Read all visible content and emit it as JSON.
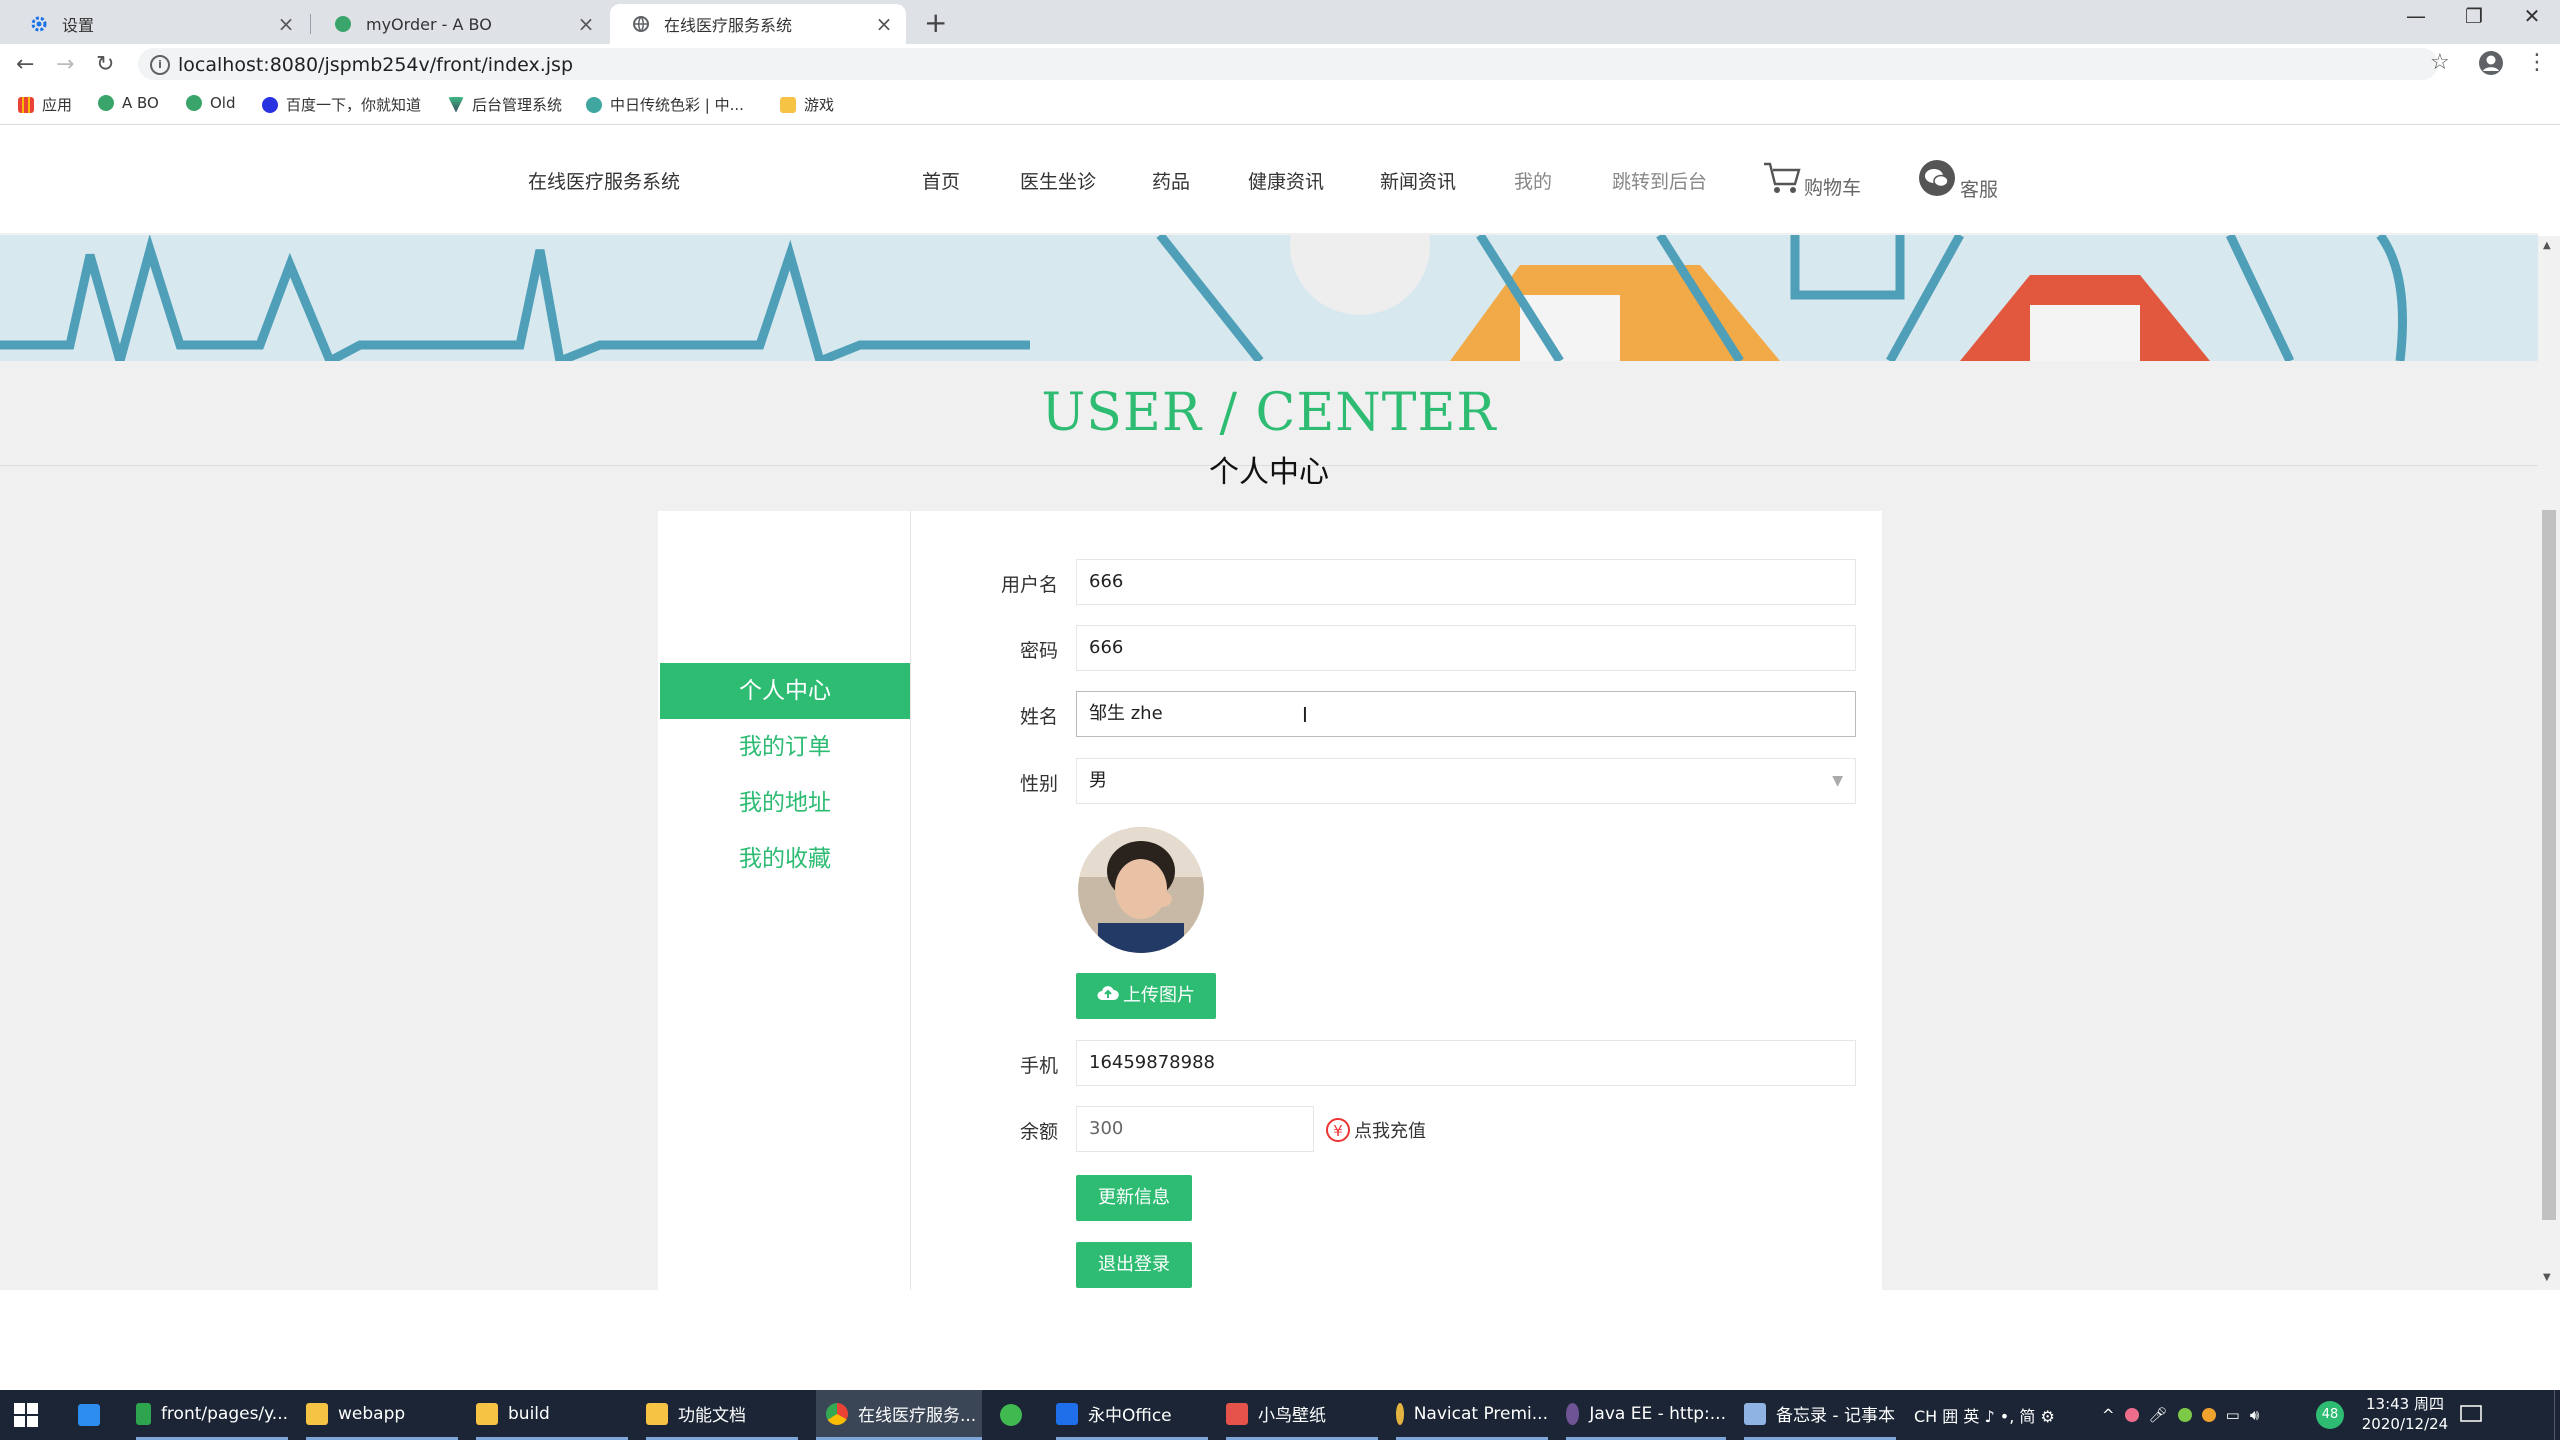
{
  "browser": {
    "tabs": [
      {
        "title": "设置"
      },
      {
        "title": "myOrder - A BO"
      },
      {
        "title": "在线医疗服务系统"
      }
    ],
    "url": "localhost:8080/jspmb254v/front/index.jsp",
    "bookmarks": [
      "应用",
      "A BO",
      "Old",
      "百度一下，你就知道",
      "后台管理系统",
      "中日传统色彩 | 中...",
      "游戏"
    ]
  },
  "site": {
    "brand": "在线医疗服务系统",
    "nav": [
      "首页",
      "医生坐诊",
      "药品",
      "健康资讯",
      "新闻资讯",
      "我的",
      "跳转到后台"
    ],
    "cart_label": "购物车",
    "service_label": "客服"
  },
  "user_center": {
    "title": "USER / CENTER",
    "subtitle": "个人中心",
    "sidebar": [
      "个人中心",
      "我的订单",
      "我的地址",
      "我的收藏"
    ],
    "form": {
      "username_label": "用户名",
      "username_value": "666",
      "password_label": "密码",
      "password_value": "666",
      "name_label": "姓名",
      "name_value": "邹生 zhe",
      "gender_label": "性别",
      "gender_value": "男",
      "upload_label": "上传图片",
      "phone_label": "手机",
      "phone_value": "16459878988",
      "balance_label": "余额",
      "balance_value": "300",
      "recharge_label": "点我充值",
      "update_button": "更新信息",
      "logout_button": "退出登录"
    }
  },
  "taskbar": {
    "items": [
      "front/pages/y...",
      "webapp",
      "build",
      "功能文档",
      "在线医疗服务...",
      "永中Office",
      "小鸟壁纸",
      "Navicat Premi...",
      "Java EE - http:...",
      "备忘录 - 记事本"
    ],
    "tray_text": "CH 囲 英 ♪ •, 简 ⚙",
    "badge": "48",
    "time": "13:43 周四",
    "date": "2020/12/24"
  },
  "colors": {
    "accent": "#2ebc73",
    "taskbar": "#1b2535"
  }
}
